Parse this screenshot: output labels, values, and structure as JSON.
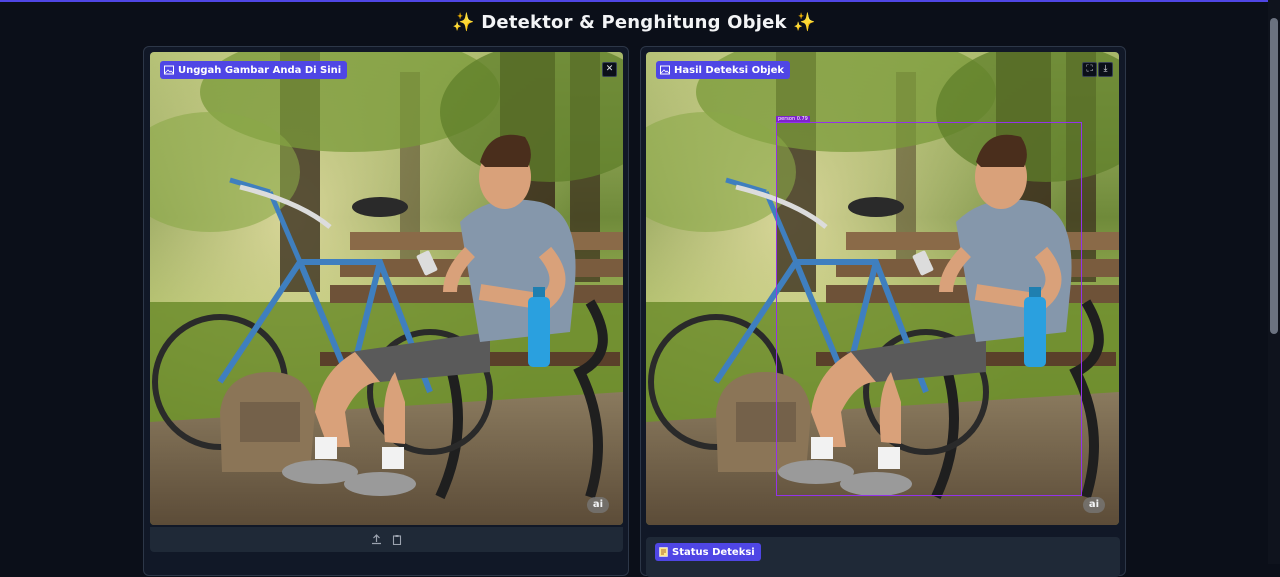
{
  "page": {
    "title": "Detektor & Penghitung Objek",
    "title_sparkle": "✨"
  },
  "input_panel": {
    "label": "Unggah Gambar Anda Di Sini",
    "label_icon": "image-icon",
    "clear_icon": "close-icon",
    "watermark": "ai",
    "upload_icon": "upload-icon",
    "paste_icon": "clipboard-icon"
  },
  "output_panel": {
    "label": "Hasil Deteksi Objek",
    "label_icon": "image-icon",
    "fullscreen_icon": "fullscreen-icon",
    "download_icon": "download-icon",
    "watermark": "ai",
    "detection": {
      "class": "person",
      "score": "0.79"
    }
  },
  "status": {
    "label": "Status Deteksi",
    "icon": "document-icon"
  },
  "colors": {
    "accent": "#4f46e5",
    "detection_box": "#9333ea",
    "background": "#0b0f19"
  }
}
